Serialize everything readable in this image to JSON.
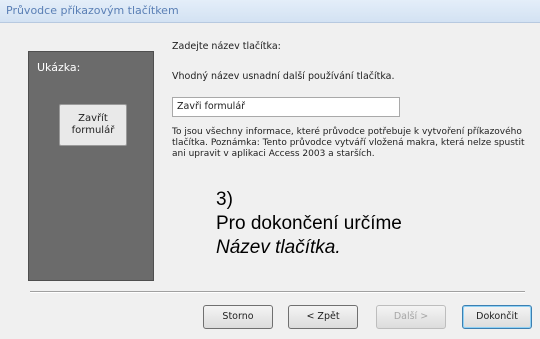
{
  "window": {
    "title": "Průvodce příkazovým tlačítkem"
  },
  "preview": {
    "label": "Ukázka:",
    "button_text": "Zavřít formulář"
  },
  "main": {
    "prompt": "Zadejte název tlačítka:",
    "hint": "Vhodný název usnadní další používání tlačítka.",
    "name_value": "Zavři formulář",
    "info": "To jsou všechny informace, které průvodce potřebuje k vytvoření příkazového tlačítka. Poznámka: Tento průvodce vytváří vložená makra, která nelze spustit ani upravit v aplikaci Access 2003 a starších."
  },
  "callout": {
    "line1": "3)",
    "line2": "Pro dokončení určíme",
    "line3": "Název tlačítka."
  },
  "buttons": {
    "cancel": "Storno",
    "back": "< Zpět",
    "next": "Další >",
    "finish": "Dokončit"
  }
}
